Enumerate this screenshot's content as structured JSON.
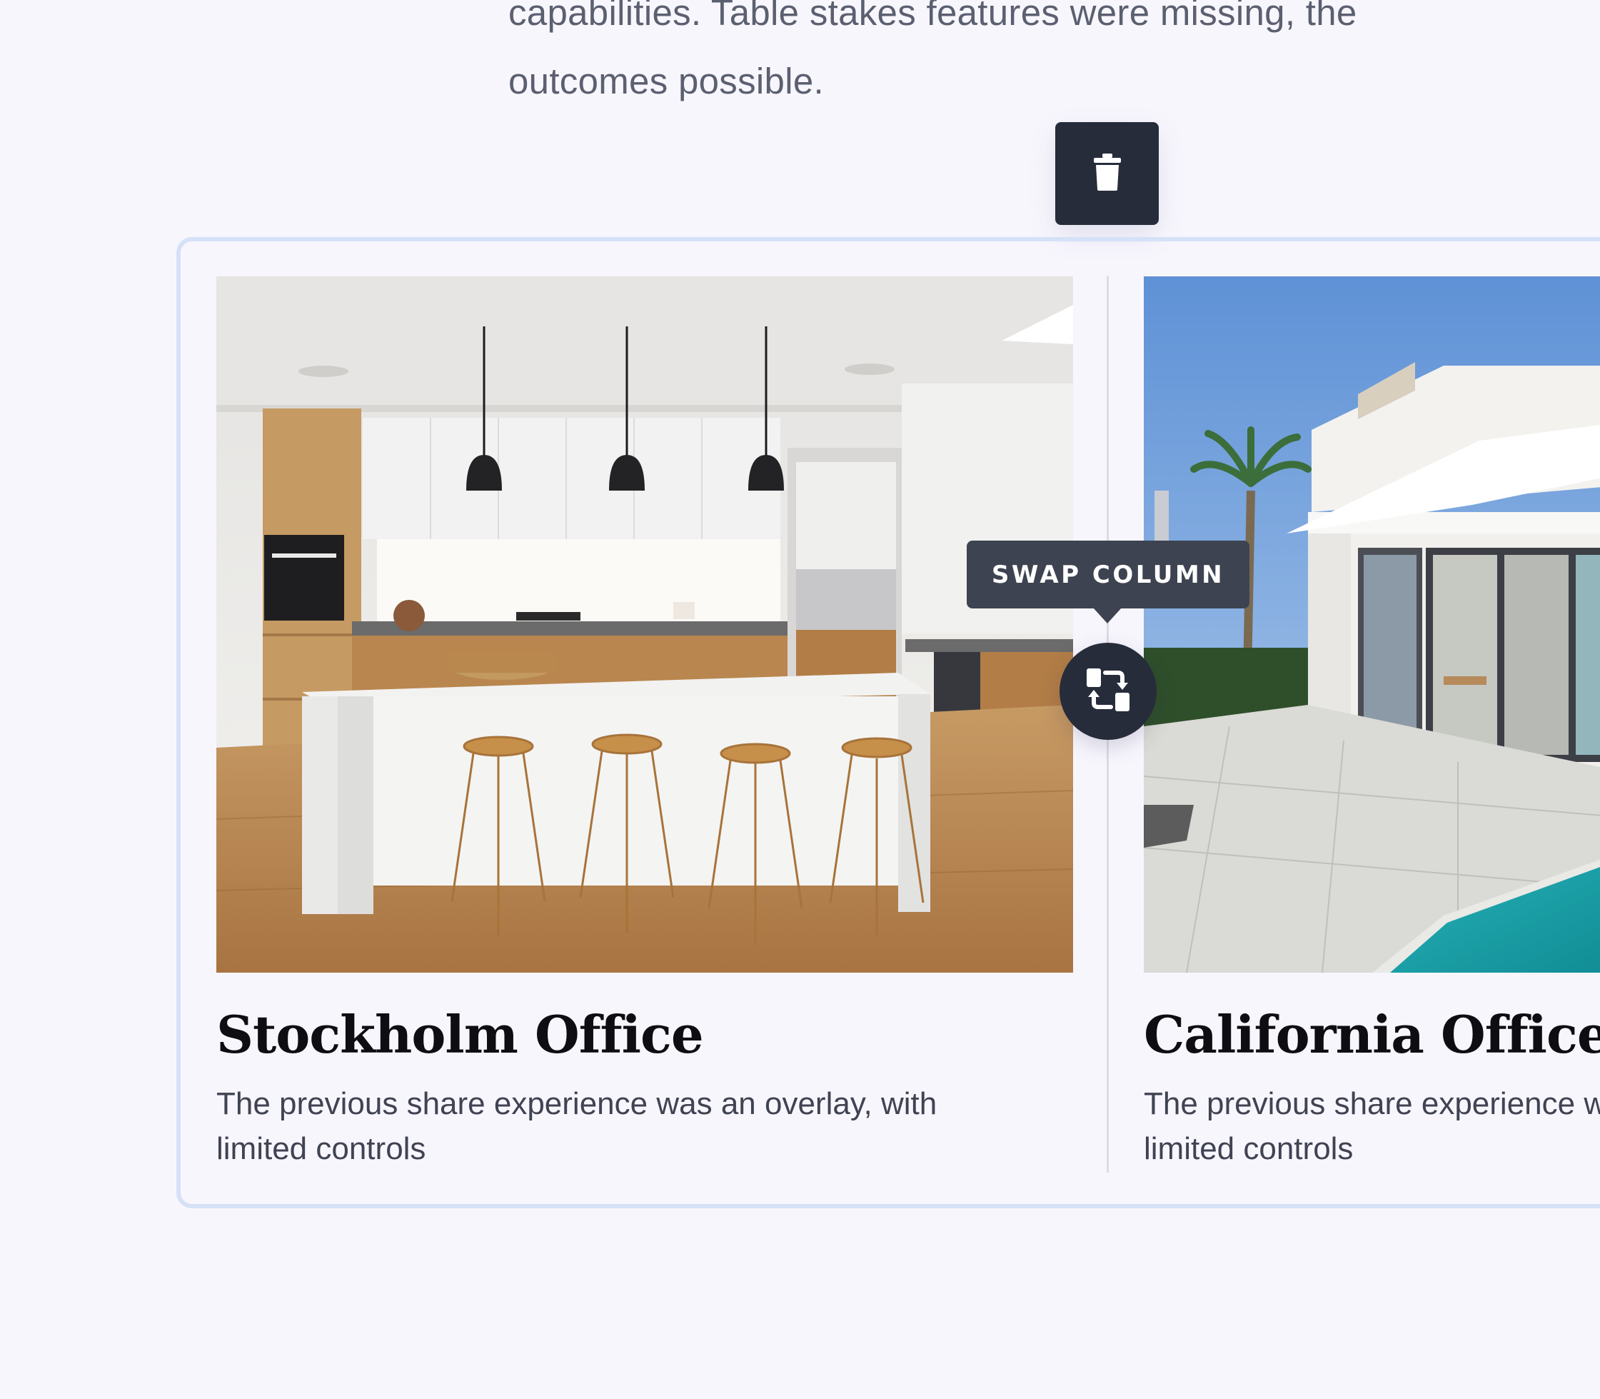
{
  "intro": {
    "text": "capabilities. Table stakes features were missing, the outcomes possible."
  },
  "toolbar": {
    "delete_icon": "trash-icon",
    "swap_icon": "swap-icon",
    "swap_tooltip": "SWAP COLUMN"
  },
  "columns": [
    {
      "title": "Stockholm Office",
      "description": "The previous share experience was an overlay, with limited controls",
      "image": "kitchen-photo"
    },
    {
      "title": "California Office",
      "description": "The previous share experience was an overlay, with limited controls",
      "image": "house-pool-photo"
    }
  ],
  "colors": {
    "background": "#f8f6fd",
    "dark_button": "#262c3a",
    "tooltip": "#3d4350",
    "selection_border": "#d5e1f7"
  }
}
